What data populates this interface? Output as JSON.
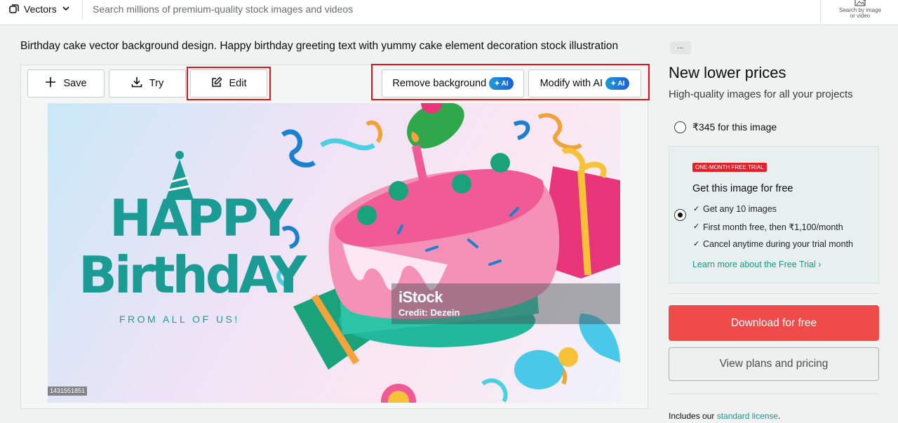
{
  "header": {
    "asset_type": "Vectors",
    "search_placeholder": "Search millions of premium-quality stock images and videos",
    "search_by_image_line1": "Search by image",
    "search_by_image_line2": "or video"
  },
  "asset": {
    "title": "Birthday cake vector background design. Happy birthday greeting text with yummy cake element decoration stock illustration",
    "more_label": "...",
    "image_id": "1431551851"
  },
  "toolbar": {
    "save_label": "Save",
    "try_label": "Try",
    "edit_label": "Edit",
    "remove_bg_label": "Remove background",
    "modify_ai_label": "Modify with AI",
    "ai_badge": "AI"
  },
  "artwork": {
    "line1": "HAPPY",
    "line2": "BirthdAY",
    "subline": "FROM ALL OF US!",
    "watermark_brand": "iStock",
    "watermark_credit": "Credit: Dezein"
  },
  "pricing": {
    "heading": "New lower prices",
    "subheading": "High-quality images for all your projects",
    "single_price_option": "₹345 for this image",
    "trial_badge": "ONE-MONTH FREE TRIAL",
    "trial_heading": "Get this image for free",
    "trial_points": [
      "Get any 10 images",
      "First month free, then ₹1,100/month",
      "Cancel anytime during your trial month"
    ],
    "learn_more": "Learn more about the Free Trial ›",
    "download_button": "Download for free",
    "plans_button": "View plans and pricing",
    "license_prefix": "Includes our",
    "license_link": "standard license",
    "license_suffix": "."
  },
  "colors": {
    "accent_red": "#f04b4b",
    "teal_link": "#1d9586",
    "highlight_box": "#e0131b"
  }
}
